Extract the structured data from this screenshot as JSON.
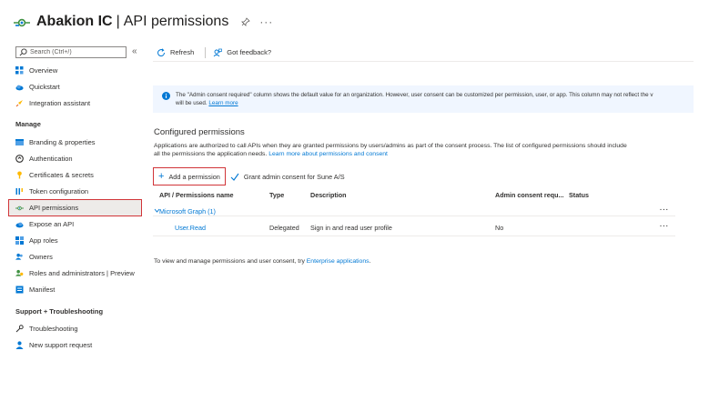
{
  "title": {
    "app": "Abakion IC",
    "separator": "|",
    "page": "API permissions",
    "more": "···"
  },
  "sidebar": {
    "search_placeholder": "Search (Ctrl+/)",
    "collapse_glyph": "«",
    "top_items": [
      {
        "label": "Overview",
        "icon": "grid-icon"
      },
      {
        "label": "Quickstart",
        "icon": "cloud-icon"
      },
      {
        "label": "Integration assistant",
        "icon": "rocket-icon"
      }
    ],
    "manage_heading": "Manage",
    "manage_items": [
      {
        "label": "Branding & properties",
        "icon": "branding-icon"
      },
      {
        "label": "Authentication",
        "icon": "authentication-icon"
      },
      {
        "label": "Certificates & secrets",
        "icon": "key-icon"
      },
      {
        "label": "Token configuration",
        "icon": "token-icon"
      },
      {
        "label": "API permissions",
        "icon": "api-permissions-icon",
        "active": true
      },
      {
        "label": "Expose an API",
        "icon": "cloud-api-icon"
      },
      {
        "label": "App roles",
        "icon": "app-roles-icon"
      },
      {
        "label": "Owners",
        "icon": "owners-icon"
      },
      {
        "label": "Roles and administrators | Preview",
        "icon": "roles-icon"
      },
      {
        "label": "Manifest",
        "icon": "manifest-icon"
      }
    ],
    "support_heading": "Support + Troubleshooting",
    "support_items": [
      {
        "label": "Troubleshooting",
        "icon": "wrench-icon"
      },
      {
        "label": "New support request",
        "icon": "support-person-icon"
      }
    ]
  },
  "toolbar": {
    "refresh_label": "Refresh",
    "feedback_label": "Got feedback?"
  },
  "info": {
    "line1": "The \"Admin consent required\" column shows the default value for an organization. However, user consent can be customized per permission, user, or app. This column may not reflect the v",
    "line2": "will be used.",
    "learn_more": "Learn more"
  },
  "configured": {
    "title": "Configured permissions",
    "desc_line1": "Applications are authorized to call APIs when they are granted permissions by users/admins as part of the consent process. The list of configured permissions should include",
    "desc_line2": "all the permissions the application needs.",
    "desc_link": "Learn more about permissions and consent"
  },
  "actions": {
    "add_permission": "Add a permission",
    "grant_consent": "Grant admin consent for Sune A/S"
  },
  "table": {
    "headers": {
      "name": "API / Permissions name",
      "type": "Type",
      "description": "Description",
      "admin_consent": "Admin consent requ...",
      "status": "Status"
    },
    "group": {
      "label": "Microsoft Graph (1)",
      "ellipsis": "···"
    },
    "rows": [
      {
        "name": "User.Read",
        "type": "Delegated",
        "description": "Sign in and read user profile",
        "admin_consent": "No",
        "status": "",
        "ellipsis": "···"
      }
    ]
  },
  "footer": {
    "text": "To view and manage permissions and user consent, try",
    "link": "Enterprise applications",
    "end": "."
  },
  "colors": {
    "accent": "#0078d4",
    "highlight_border": "#d13438",
    "info_bg": "#f0f6ff",
    "active_bg": "#edebe9"
  }
}
